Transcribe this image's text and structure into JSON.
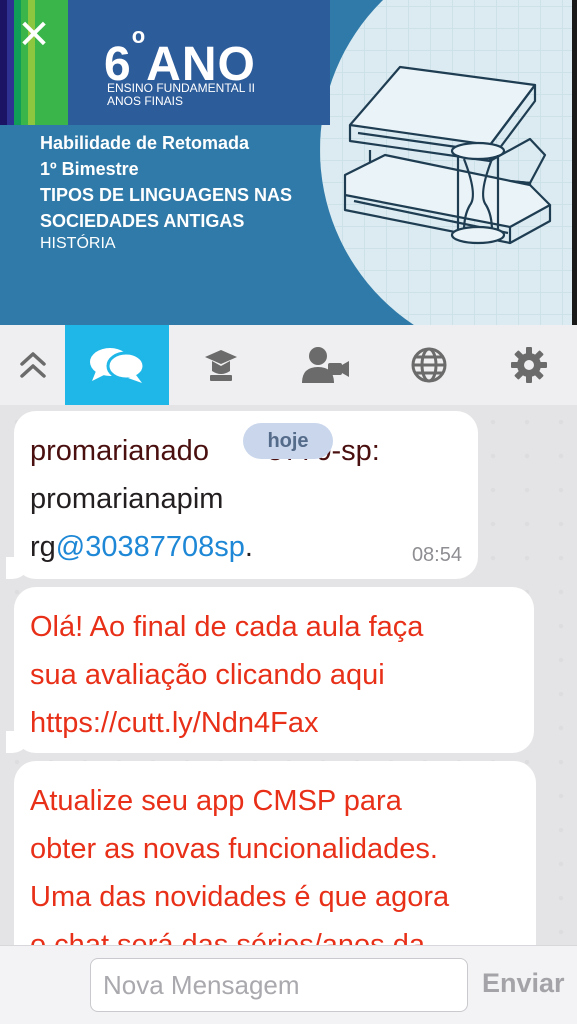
{
  "banner": {
    "close_glyph": "✕",
    "grade_number": "6",
    "grade_ordinal": "o",
    "grade_word": "ANO",
    "level_line1": "ENSINO FUNDAMENTAL II",
    "level_line2": "ANOS FINAIS",
    "lesson_line1": "Habilidade de Retomada",
    "lesson_line2": "1º Bimestre",
    "lesson_line3": "TIPOS DE LINGUAGENS NAS",
    "lesson_line4": "SOCIEDADES ANTIGAS",
    "subject": "HISTÓRIA",
    "stripe_colors": [
      "#1b1464",
      "#2e3192",
      "#0f9d58",
      "#8dc63f",
      "#39b54a"
    ],
    "band_color": "#2d5c9b",
    "background_color": "#2f7aa8"
  },
  "toolbar": {
    "items": [
      {
        "icon": "collapse-chevrons-icon"
      },
      {
        "icon": "chat-bubbles-icon",
        "active": true
      },
      {
        "icon": "graduation-cap-icon"
      },
      {
        "icon": "video-user-icon"
      },
      {
        "icon": "globe-icon"
      },
      {
        "icon": "gear-icon"
      }
    ],
    "active_color": "#1fb6e8",
    "icon_color": "#6b6b6b"
  },
  "chat": {
    "date_label": "hoje",
    "messages": [
      {
        "sender": "promarianado",
        "sender_tail": "3770-sp:",
        "line2": "promarianapim",
        "line3_prefix": "rg",
        "mention": "@30387708sp",
        "line3_suffix": ".",
        "time": "08:54"
      },
      {
        "line1": "Olá! Ao final de cada aula faça",
        "line2": "sua avaliação clicando aqui",
        "line3": "https://cutt.ly/Ndn4Fax"
      },
      {
        "line1": "Atualize seu app CMSP para",
        "line2": "obter as novas funcionalidades.",
        "line3": "Uma das novidades é que agora",
        "line4": "o chat será das séries/anos da"
      }
    ],
    "alert_text_color": "#e83019",
    "mention_color": "#1e88d6"
  },
  "composer": {
    "placeholder": "Nova Mensagem",
    "value": "",
    "send_label": "Enviar"
  }
}
